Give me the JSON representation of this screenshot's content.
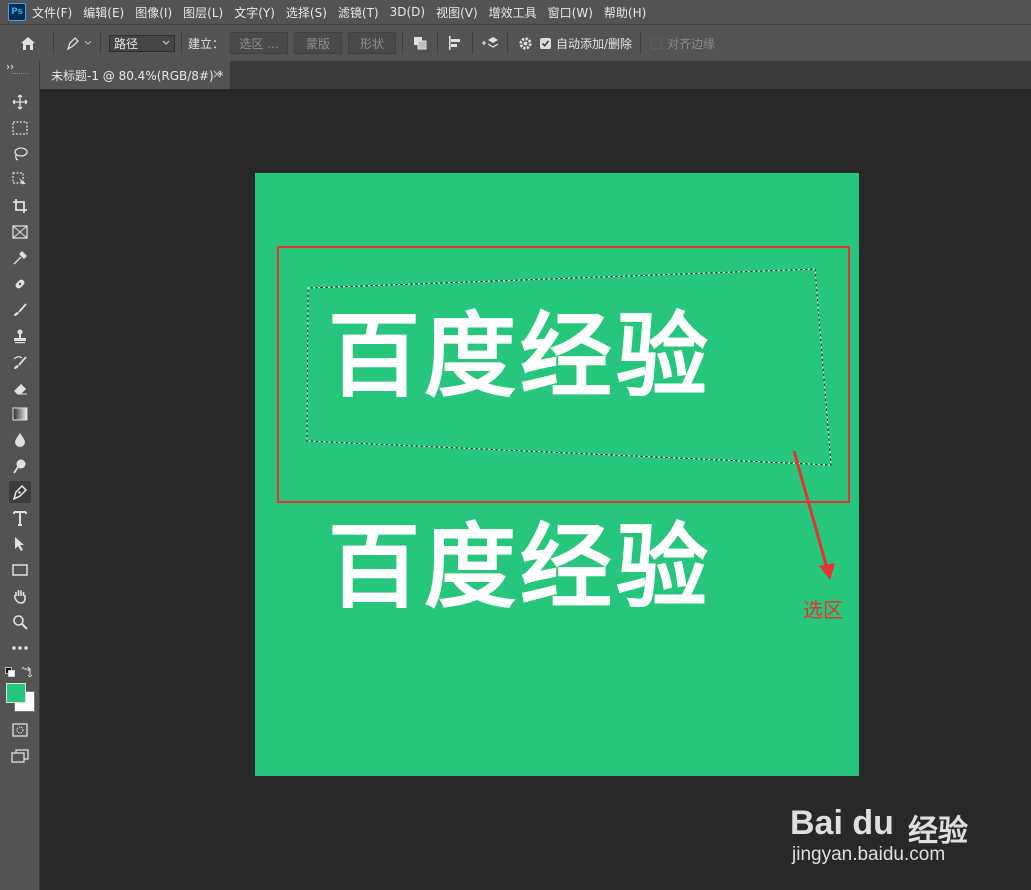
{
  "app": {
    "logo_text": "Ps"
  },
  "menu": [
    "文件(F)",
    "编辑(E)",
    "图像(I)",
    "图层(L)",
    "文字(Y)",
    "选择(S)",
    "滤镜(T)",
    "3D(D)",
    "视图(V)",
    "增效工具",
    "窗口(W)",
    "帮助(H)"
  ],
  "options_bar": {
    "mode_value": "路径",
    "make_label": "建立：",
    "selection_button": "选区 ...",
    "mask_button": "蒙版",
    "shape_button": "形状",
    "auto_add_delete_label": "自动添加/删除",
    "auto_add_delete_checked": true,
    "align_edges_label": "对齐边缘",
    "align_edges_checked": false
  },
  "document_tab": {
    "title": "未标题-1 @ 80.4%(RGB/8#) *",
    "close": "×"
  },
  "canvas": {
    "background_color": "#26c77d",
    "text_top": "百度经验",
    "text_bottom": "百度经验",
    "annotation_label": "选区",
    "annotation_color": "#e53232"
  },
  "colors": {
    "foreground": "#26c77d",
    "background": "#ffffff"
  },
  "watermark": {
    "logo": "Bai du",
    "cn": "经验",
    "url": "jingyan.baidu.com"
  }
}
